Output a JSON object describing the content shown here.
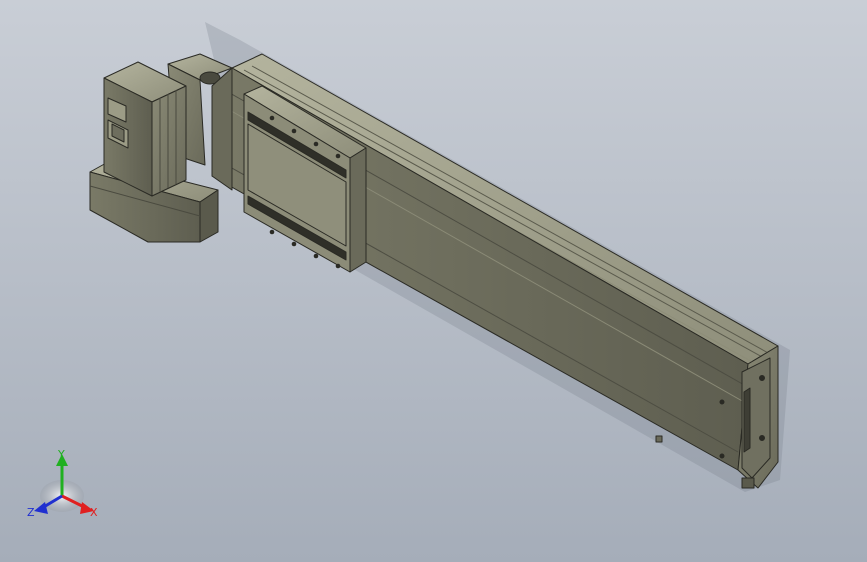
{
  "viewport": {
    "background_top": "#c9ced6",
    "background_bottom": "#a5adb9"
  },
  "model": {
    "body_color": "#7c7c68",
    "body_dark": "#55554a",
    "body_light": "#a2a28c",
    "edge_color": "#2a2a24"
  },
  "triad": {
    "x_label": "X",
    "y_label": "Y",
    "z_label": "Z",
    "x_color": "#e02020",
    "y_color": "#20b020",
    "z_color": "#2030d0"
  }
}
